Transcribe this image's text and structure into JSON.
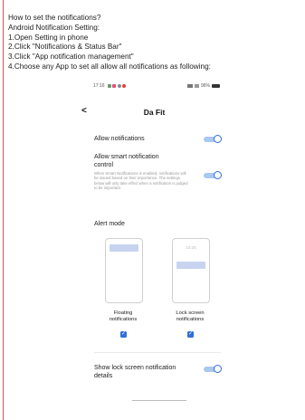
{
  "instructions": {
    "lines": [
      "How to set the notifications?",
      "Android Notification Setting:",
      "1.Open Setting in phone",
      "2.Click \"Notifications & Status Bar\"",
      "3.Click \"App notification management\"",
      "4.Choose any App to set all allow all notifications as following:"
    ]
  },
  "phone": {
    "status_time": "17:16",
    "status_right": "96%",
    "back_glyph": "<",
    "title": "Da Fit",
    "allow_notifications_label": "Allow notifications",
    "allow_notifications_on": true,
    "smart_label_line1": "Allow smart notification",
    "smart_label_line2": "control",
    "smart_desc": "When Smart Notifications is enabled, notifications will be issued based on their importance. The settings below will only take effect when a notification is judged to be important.",
    "smart_on": true,
    "alert_mode_label": "Alert mode",
    "lock_preview_time": "10:25",
    "floating_label_line1": "Floating",
    "floating_label_line2": "notifications",
    "floating_checked": true,
    "lock_label_line1": "Lock screen",
    "lock_label_line2": "notifications",
    "lock_checked": true,
    "show_lock_line1": "Show lock screen notification",
    "show_lock_line2": "details",
    "show_lock_on": true,
    "check_glyph": "✓"
  },
  "colors": {
    "accent": "#2f6fd6",
    "track": "#a9c8f2",
    "margin_line": "#d9534f"
  }
}
